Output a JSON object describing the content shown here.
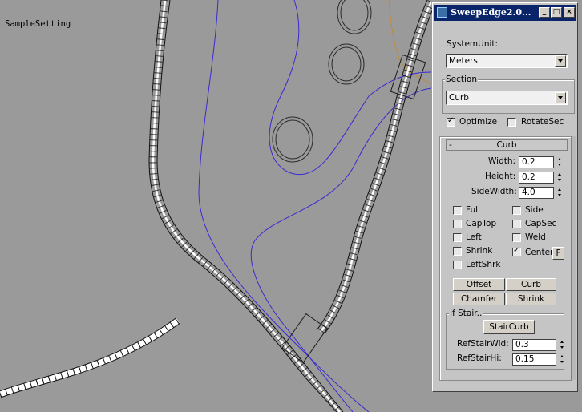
{
  "window": {
    "title": "SweepEdge2.0...",
    "min_label": "_",
    "max_label": "□",
    "close_label": "×"
  },
  "menu": {
    "item": "SampleSetting"
  },
  "system_unit": {
    "label": "SystemUnit:",
    "value": "Meters"
  },
  "section": {
    "label": "Section",
    "value": "Curb"
  },
  "options": {
    "optimize": "Optimize",
    "optimize_checked": true,
    "rotatesec": "RotateSec",
    "rotatesec_checked": false
  },
  "curb": {
    "collapse": "-",
    "title": "Curb",
    "width_label": "Width:",
    "width": "0.2",
    "height_label": "Height:",
    "height": "0.2",
    "sidewidth_label": "SideWidth:",
    "sidewidth": "4.0",
    "checks": [
      {
        "label": "Full",
        "checked": false
      },
      {
        "label": "Side",
        "checked": false
      },
      {
        "label": "CapTop",
        "checked": false
      },
      {
        "label": "CapSec",
        "checked": false
      },
      {
        "label": "Left",
        "checked": false
      },
      {
        "label": "Weld",
        "checked": false
      },
      {
        "label": "Shrink",
        "checked": false
      },
      {
        "label": "Center",
        "checked": true
      },
      {
        "label": "LeftShrk",
        "checked": false
      }
    ],
    "f_button": "F",
    "buttons": [
      "Offset",
      "Curb",
      "Chamfer",
      "Shrink"
    ]
  },
  "stair": {
    "group_label": "If Stair..",
    "button": "StairCurb",
    "refwid_label": "RefStairWid:",
    "refwid": "0.3",
    "refhi_label": "RefStairHi:",
    "refhi": "0.15"
  },
  "colors": {
    "viewport": "#9a9a9a",
    "spline": "#3a2ad0",
    "curb_line": "#000000",
    "titlebar": "#0a246a"
  }
}
